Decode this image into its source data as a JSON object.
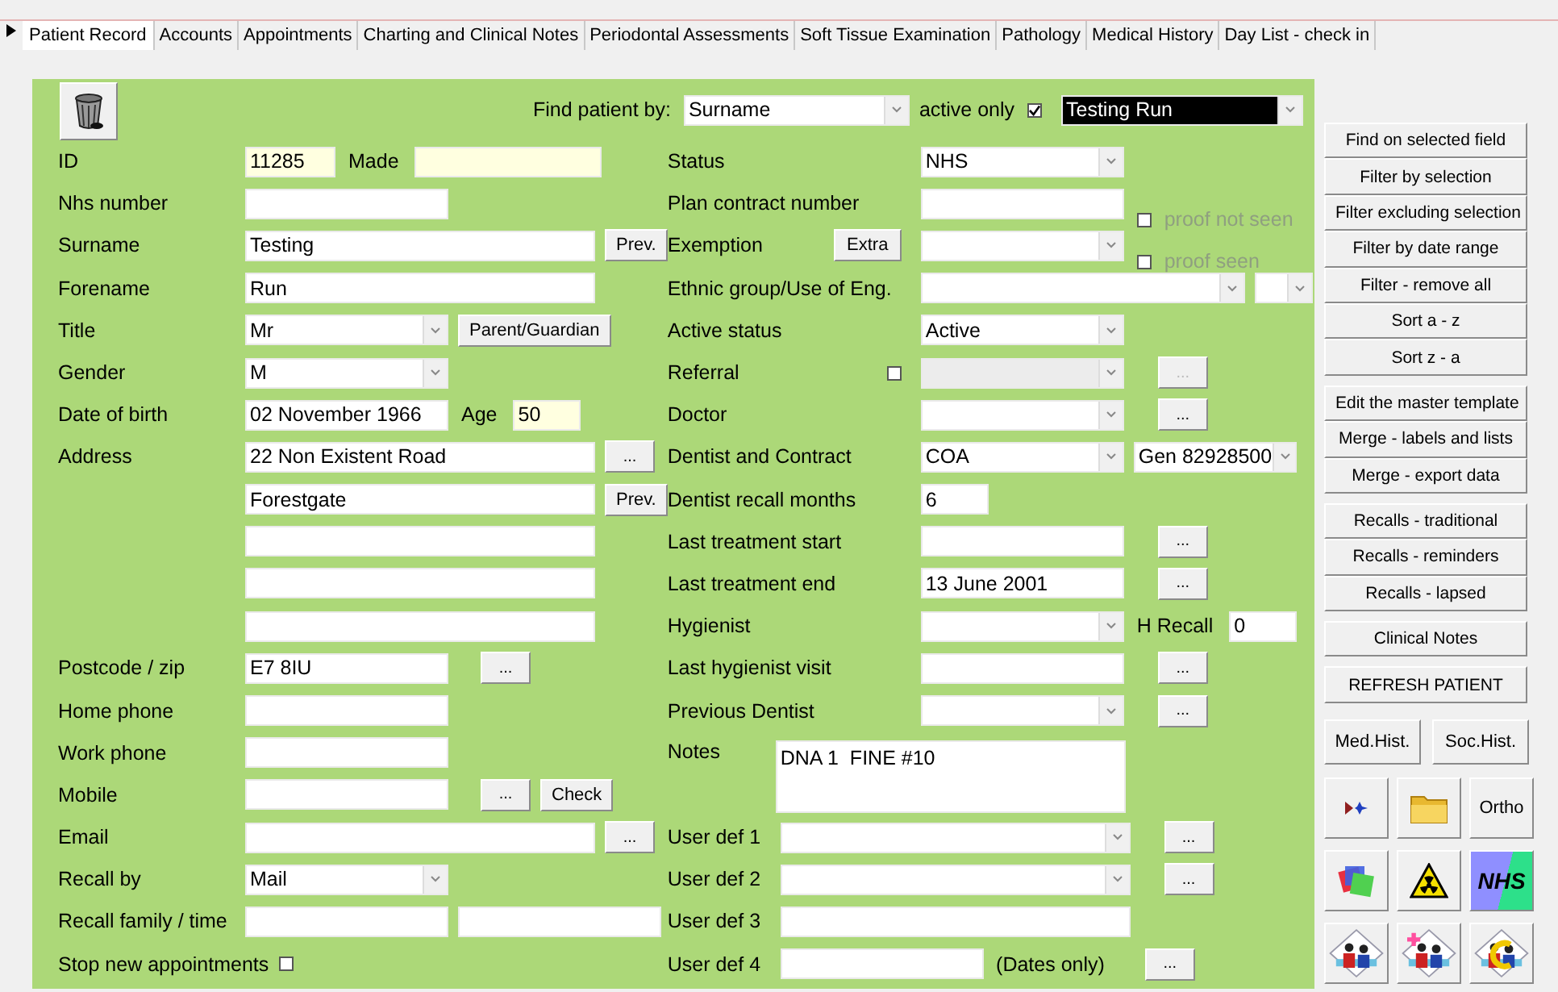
{
  "tabs": [
    {
      "label": "Patient Record",
      "selected": true
    },
    {
      "label": "Accounts",
      "selected": false
    },
    {
      "label": "Appointments",
      "selected": false
    },
    {
      "label": "Charting and Clinical Notes",
      "selected": false
    },
    {
      "label": "Periodontal Assessments",
      "selected": false
    },
    {
      "label": "Soft Tissue Examination",
      "selected": false
    },
    {
      "label": "Pathology",
      "selected": false
    },
    {
      "label": "Medical History",
      "selected": false
    },
    {
      "label": "Day List - check in",
      "selected": false
    }
  ],
  "finder": {
    "label": "Find patient by:",
    "find_by": "Surname",
    "active_only_label": "active only",
    "active_only": true,
    "patient": "Testing Run"
  },
  "left_rows": [
    {
      "label": "ID",
      "controls": [
        {
          "kind": "readonly",
          "value": "11285"
        },
        {
          "kind": "label",
          "text": "Made"
        },
        {
          "kind": "readonly"
        }
      ]
    },
    {
      "label": "Nhs number",
      "controls": [
        {
          "kind": "text"
        }
      ]
    },
    {
      "label": "Surname",
      "controls": [
        {
          "kind": "text",
          "value": "Testing"
        },
        {
          "kind": "button",
          "label": "Prev."
        }
      ]
    },
    {
      "label": "Forename",
      "controls": [
        {
          "kind": "text",
          "value": "Run"
        }
      ]
    },
    {
      "label": "Title",
      "controls": [
        {
          "kind": "combo",
          "value": "Mr"
        },
        {
          "kind": "button",
          "label": "Parent/Guardian"
        }
      ]
    },
    {
      "label": "Gender",
      "controls": [
        {
          "kind": "combo",
          "value": "M"
        }
      ]
    },
    {
      "label": "Date of birth",
      "controls": [
        {
          "kind": "text",
          "value": "02 November 1966"
        },
        {
          "kind": "label",
          "text": "Age"
        },
        {
          "kind": "readonly",
          "value": "50"
        }
      ]
    },
    {
      "label": "Address",
      "controls": [
        {
          "kind": "text",
          "value": "22 Non Existent Road"
        },
        {
          "kind": "more",
          "label": "..."
        }
      ]
    },
    {
      "controls": [
        {
          "kind": "text",
          "value": "Forestgate"
        },
        {
          "kind": "button",
          "label": "Prev."
        }
      ]
    },
    {
      "controls": [
        {
          "kind": "text"
        }
      ]
    },
    {
      "controls": [
        {
          "kind": "text"
        }
      ]
    },
    {
      "controls": [
        {
          "kind": "text"
        }
      ]
    },
    {
      "label": "Postcode / zip",
      "controls": [
        {
          "kind": "text",
          "value": "E7 8IU"
        },
        {
          "kind": "more",
          "label": "..."
        }
      ]
    },
    {
      "label": "Home phone",
      "controls": [
        {
          "kind": "text"
        }
      ]
    },
    {
      "label": "Work phone",
      "controls": [
        {
          "kind": "text"
        }
      ]
    },
    {
      "label": "Mobile",
      "controls": [
        {
          "kind": "text"
        },
        {
          "kind": "more",
          "label": "..."
        },
        {
          "kind": "button",
          "label": "Check"
        }
      ]
    },
    {
      "label": "Email",
      "controls": [
        {
          "kind": "text"
        },
        {
          "kind": "more",
          "label": "..."
        }
      ]
    },
    {
      "label": "Recall by",
      "controls": [
        {
          "kind": "combo",
          "value": "Mail"
        }
      ]
    },
    {
      "label": "Recall family / time",
      "controls": [
        {
          "kind": "text"
        },
        {
          "kind": "text"
        }
      ]
    },
    {
      "label": "Stop new appointments",
      "controls": [
        {
          "kind": "checkbox",
          "checked": false
        }
      ]
    }
  ],
  "right_rows": [
    {
      "kind": "field",
      "label": "Status",
      "controls": [
        {
          "kind": "combo",
          "value": "NHS"
        }
      ]
    },
    {
      "kind": "field",
      "label": "Plan contract number",
      "controls": [
        {
          "kind": "text"
        },
        {
          "kind": "checkbox",
          "checked": false,
          "disabled": true,
          "label": "proof not seen"
        }
      ]
    },
    {
      "kind": "field",
      "label": "Exemption",
      "extras": [
        {
          "kind": "button",
          "label": "Extra"
        }
      ],
      "controls": [
        {
          "kind": "combo"
        },
        {
          "kind": "checkbox",
          "checked": false,
          "disabled": true,
          "label": "proof seen"
        }
      ]
    },
    {
      "kind": "field",
      "label": "Ethnic group/Use of Eng.",
      "controls": [
        {
          "kind": "combo"
        },
        {
          "kind": "combo"
        }
      ]
    },
    {
      "kind": "field",
      "label": "Active status",
      "controls": [
        {
          "kind": "combo",
          "value": "Active"
        }
      ]
    },
    {
      "kind": "field",
      "label": "Referral",
      "extras": [
        {
          "kind": "checkbox",
          "checked": false
        }
      ],
      "controls": [
        {
          "kind": "combo",
          "disabled": true
        },
        {
          "kind": "more",
          "label": "...",
          "disabled": true
        }
      ]
    },
    {
      "kind": "field",
      "label": "Doctor",
      "controls": [
        {
          "kind": "combo"
        },
        {
          "kind": "more",
          "label": "..."
        }
      ]
    },
    {
      "kind": "field",
      "label": "Dentist and Contract",
      "controls": [
        {
          "kind": "combo",
          "value": "COA"
        },
        {
          "kind": "combo",
          "value": "Gen 82928500"
        }
      ]
    },
    {
      "kind": "field",
      "label": "Dentist recall months",
      "controls": [
        {
          "kind": "text",
          "value": "6"
        }
      ]
    },
    {
      "kind": "field",
      "label": "Last treatment start",
      "controls": [
        {
          "kind": "text"
        },
        {
          "kind": "more",
          "label": "..."
        }
      ]
    },
    {
      "kind": "field",
      "label": "Last treatment end",
      "controls": [
        {
          "kind": "text",
          "value": "13 June 2001"
        },
        {
          "kind": "more",
          "label": "..."
        }
      ]
    },
    {
      "kind": "field",
      "label": "Hygienist",
      "controls": [
        {
          "kind": "combo"
        },
        {
          "kind": "label",
          "text": "H Recall"
        },
        {
          "kind": "text",
          "value": "0"
        }
      ]
    },
    {
      "kind": "field",
      "label": "Last hygienist visit",
      "controls": [
        {
          "kind": "text"
        },
        {
          "kind": "more",
          "label": "..."
        }
      ]
    },
    {
      "kind": "field",
      "label": "Previous Dentist",
      "controls": [
        {
          "kind": "combo"
        },
        {
          "kind": "more",
          "label": "..."
        }
      ]
    },
    {
      "kind": "tall",
      "label": "Notes",
      "controls": [
        {
          "kind": "notes",
          "value": "DNA 1  FINE #10"
        }
      ]
    },
    {
      "kind": "wide",
      "label": "User def 1",
      "controls": [
        {
          "kind": "combo"
        },
        {
          "kind": "more",
          "label": "..."
        }
      ]
    },
    {
      "kind": "wide",
      "label": "User def 2",
      "controls": [
        {
          "kind": "combo"
        },
        {
          "kind": "more",
          "label": "..."
        }
      ]
    },
    {
      "kind": "wide",
      "label": "User def 3",
      "controls": [
        {
          "kind": "text"
        }
      ]
    },
    {
      "kind": "wide",
      "label": "User def 4",
      "controls": [
        {
          "kind": "text"
        },
        {
          "kind": "label",
          "text": "(Dates only)"
        },
        {
          "kind": "more",
          "label": "..."
        }
      ]
    }
  ],
  "side_groups": [
    {
      "kind": "stack",
      "buttons": [
        "Find on selected field",
        "Filter by selection",
        "Filter excluding selection",
        "Filter by date range",
        "Filter - remove all",
        "Sort a - z",
        "Sort z - a"
      ]
    },
    {
      "kind": "stack",
      "buttons": [
        "Edit the master template",
        "Merge - labels and lists",
        "Merge - export data"
      ]
    },
    {
      "kind": "stack",
      "buttons": [
        "Recalls - traditional",
        "Recalls - reminders",
        "Recalls - lapsed"
      ]
    },
    {
      "kind": "stack",
      "buttons": [
        "Clinical Notes"
      ]
    },
    {
      "kind": "stack",
      "buttons": [
        "REFRESH PATIENT"
      ]
    },
    {
      "kind": "pair",
      "buttons": [
        "Med.Hist.",
        "Soc.Hist."
      ]
    }
  ],
  "tiles": [
    {
      "kind": "arrows"
    },
    {
      "kind": "folder"
    },
    {
      "kind": "text",
      "label": "Ortho"
    },
    {
      "kind": "shapes"
    },
    {
      "kind": "hazard"
    },
    {
      "kind": "logo",
      "label": "NHS"
    },
    {
      "kind": "family"
    },
    {
      "kind": "familyplus"
    },
    {
      "kind": "familyring"
    }
  ]
}
